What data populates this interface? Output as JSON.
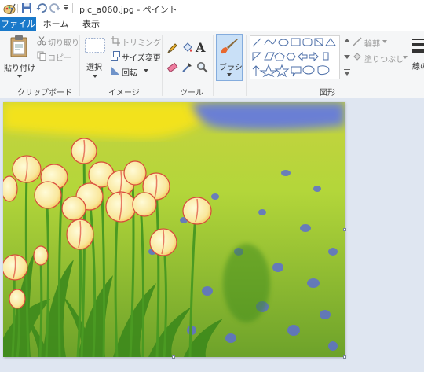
{
  "window": {
    "title": "pic_a060.jpg - ペイント"
  },
  "tabs": [
    {
      "label": "ファイル",
      "active": true
    },
    {
      "label": "ホーム",
      "active": false
    },
    {
      "label": "表示",
      "active": false
    }
  ],
  "clipboard": {
    "paste_label": "貼り付け",
    "cut_label": "切り取り",
    "copy_label": "コピー",
    "group_label": "クリップボード"
  },
  "image": {
    "select_label": "選択",
    "crop_label": "トリミング",
    "resize_label": "サイズ変更",
    "rotate_label": "回転",
    "group_label": "イメージ"
  },
  "tools": {
    "group_label": "ツール"
  },
  "brush": {
    "label": "ブラシ"
  },
  "shapes": {
    "outline_label": "輪郭",
    "fill_label": "塗りつぶし",
    "group_label": "図形"
  },
  "size": {
    "label": "線の"
  },
  "colors": {
    "accent": "#1979ca"
  }
}
